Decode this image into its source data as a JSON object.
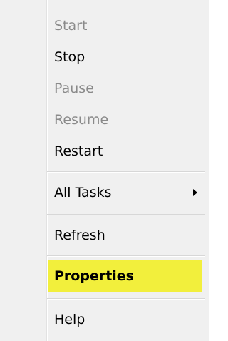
{
  "menu": {
    "items": [
      {
        "label": "Start",
        "enabled": false
      },
      {
        "label": "Stop",
        "enabled": true
      },
      {
        "label": "Pause",
        "enabled": false
      },
      {
        "label": "Resume",
        "enabled": false
      },
      {
        "label": "Restart",
        "enabled": true
      },
      {
        "label": "All Tasks",
        "enabled": true,
        "submenu": true
      },
      {
        "label": "Refresh",
        "enabled": true
      },
      {
        "label": "Properties",
        "enabled": true,
        "default": true,
        "highlighted": true,
        "highlight_color": "#f2ef3c"
      },
      {
        "label": "Help",
        "enabled": true
      }
    ]
  }
}
